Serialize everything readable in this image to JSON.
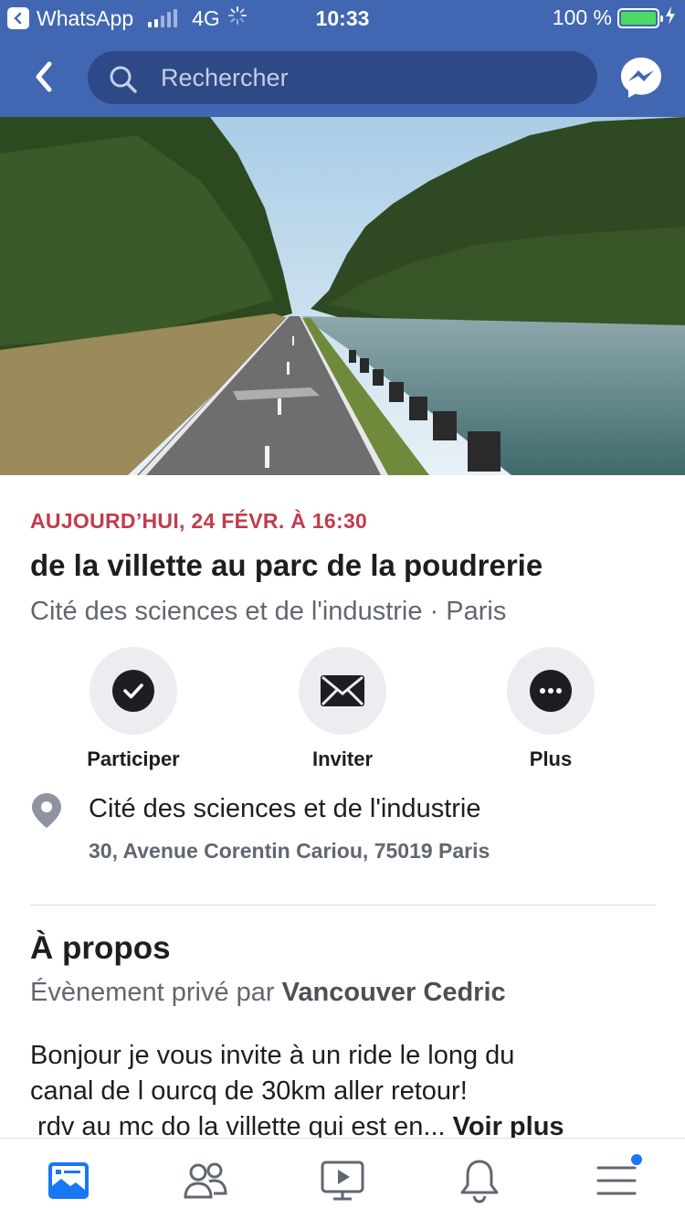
{
  "status": {
    "back_app": "WhatsApp",
    "network": "4G",
    "time": "10:33",
    "battery": "100 %"
  },
  "header": {
    "search_placeholder": "Rechercher"
  },
  "event": {
    "date": "AUJOURD’HUI, 24 FÉVR. À 16:30",
    "title": "de la villette au parc de la poudrerie",
    "subtitle": "Cité des sciences et de l'industrie · Paris"
  },
  "actions": [
    {
      "label": "Participer",
      "icon": "check-icon"
    },
    {
      "label": "Inviter",
      "icon": "envelope-icon"
    },
    {
      "label": "Plus",
      "icon": "more-icon"
    }
  ],
  "location": {
    "name": "Cité des sciences et de l'industrie",
    "address": "30, Avenue Corentin Cariou, 75019 Paris"
  },
  "about": {
    "heading": "À propos",
    "meta_prefix": "Évènement privé par",
    "organizer": "Vancouver Cedric",
    "description_lines": [
      "Bonjour je vous invite à un ride le long du",
      "canal de l ourcq de 30km aller retour!",
      " rdv au mc do la villette qui est en..."
    ],
    "see_more": "Voir plus"
  },
  "colors": {
    "brand": "#4267b2",
    "date_red": "#c23b4e",
    "secondary_text": "#606770",
    "notification_dot": "#1877f2"
  },
  "tabbar": [
    "news-feed-icon",
    "groups-icon",
    "watch-icon",
    "notifications-icon",
    "menu-icon"
  ]
}
